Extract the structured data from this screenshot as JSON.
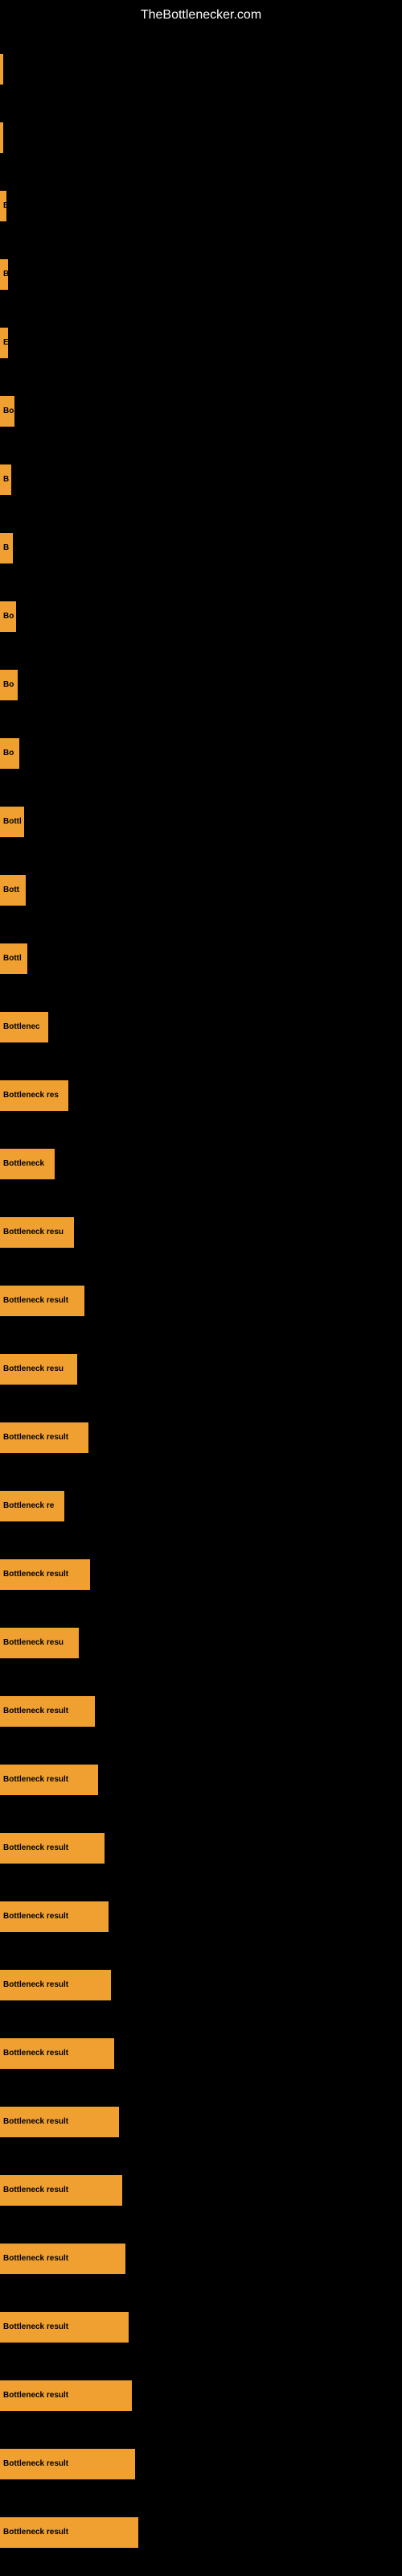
{
  "site": {
    "title": "TheBottlenecker.com"
  },
  "bars": [
    {
      "label": "|",
      "width": 4
    },
    {
      "label": "|",
      "width": 4
    },
    {
      "label": "E",
      "width": 8
    },
    {
      "label": "B",
      "width": 10
    },
    {
      "label": "E",
      "width": 10
    },
    {
      "label": "Bo",
      "width": 18
    },
    {
      "label": "B",
      "width": 14
    },
    {
      "label": "B",
      "width": 16
    },
    {
      "label": "Bo",
      "width": 20
    },
    {
      "label": "Bo",
      "width": 22
    },
    {
      "label": "Bo",
      "width": 24
    },
    {
      "label": "Bottl",
      "width": 30
    },
    {
      "label": "Bott",
      "width": 32
    },
    {
      "label": "Bottl",
      "width": 34
    },
    {
      "label": "Bottlenec",
      "width": 60
    },
    {
      "label": "Bottleneck res",
      "width": 85
    },
    {
      "label": "Bottleneck",
      "width": 68
    },
    {
      "label": "Bottleneck resu",
      "width": 92
    },
    {
      "label": "Bottleneck result",
      "width": 105
    },
    {
      "label": "Bottleneck resu",
      "width": 96
    },
    {
      "label": "Bottleneck result",
      "width": 110
    },
    {
      "label": "Bottleneck re",
      "width": 80
    },
    {
      "label": "Bottleneck result",
      "width": 112
    },
    {
      "label": "Bottleneck resu",
      "width": 98
    },
    {
      "label": "Bottleneck result",
      "width": 118
    },
    {
      "label": "Bottleneck result",
      "width": 122
    },
    {
      "label": "Bottleneck result",
      "width": 130
    },
    {
      "label": "Bottleneck result",
      "width": 135
    },
    {
      "label": "Bottleneck result",
      "width": 138
    },
    {
      "label": "Bottleneck result",
      "width": 142
    },
    {
      "label": "Bottleneck result",
      "width": 148
    },
    {
      "label": "Bottleneck result",
      "width": 152
    },
    {
      "label": "Bottleneck result",
      "width": 156
    },
    {
      "label": "Bottleneck result",
      "width": 160
    },
    {
      "label": "Bottleneck result",
      "width": 164
    },
    {
      "label": "Bottleneck result",
      "width": 168
    },
    {
      "label": "Bottleneck result",
      "width": 172
    }
  ]
}
